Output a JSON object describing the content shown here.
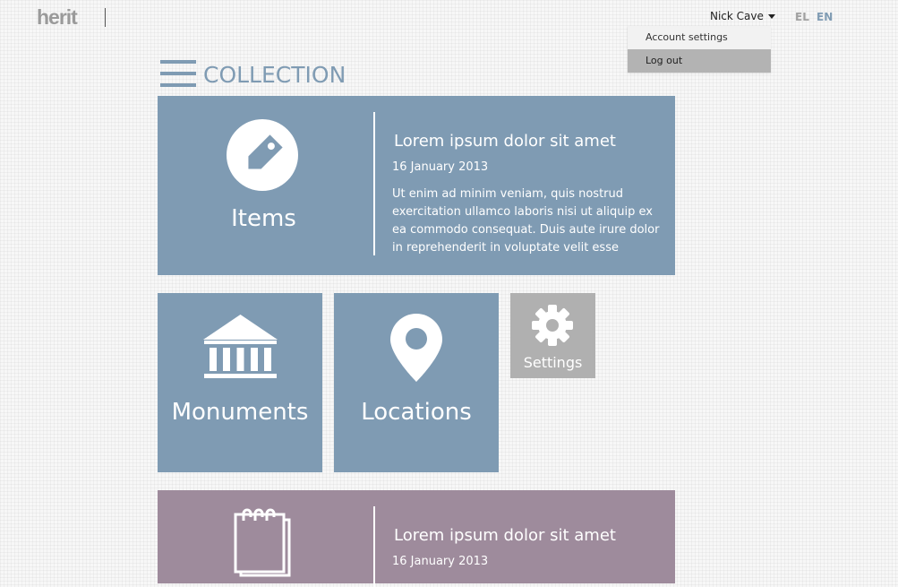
{
  "header": {
    "logo_text": "herit",
    "user_name": "Nick Cave",
    "languages": [
      "EL",
      "EN"
    ],
    "active_language": "EN",
    "user_dropdown": [
      "Account settings",
      "Log out"
    ]
  },
  "page": {
    "title": "COLLECTION"
  },
  "tiles": {
    "items": {
      "label": "Items",
      "news_title": "Lorem ipsum dolor sit amet",
      "news_date": "16 January 2013",
      "news_body": "Ut enim ad minim veniam, quis nostrud exercitation ullamco laboris nisi ut aliquip ex ea commodo consequat. Duis aute irure dolor in reprehenderit in voluptate velit esse"
    },
    "monuments": {
      "label": "Monuments"
    },
    "locations": {
      "label": "Locations"
    },
    "settings": {
      "label": "Settings"
    },
    "notes": {
      "news_title": "Lorem ipsum dolor sit amet",
      "news_date": "16 January 2013"
    }
  },
  "icons": {
    "items": "tag-icon",
    "monuments": "building-columns-icon",
    "locations": "map-pin-icon",
    "settings": "gear-icon",
    "notes": "notepad-icon",
    "menu": "hamburger-menu-icon"
  },
  "colors": {
    "accent_blue": "#7f9bb3",
    "purple": "#9e8b9c",
    "grey": "#b0b0b0"
  }
}
